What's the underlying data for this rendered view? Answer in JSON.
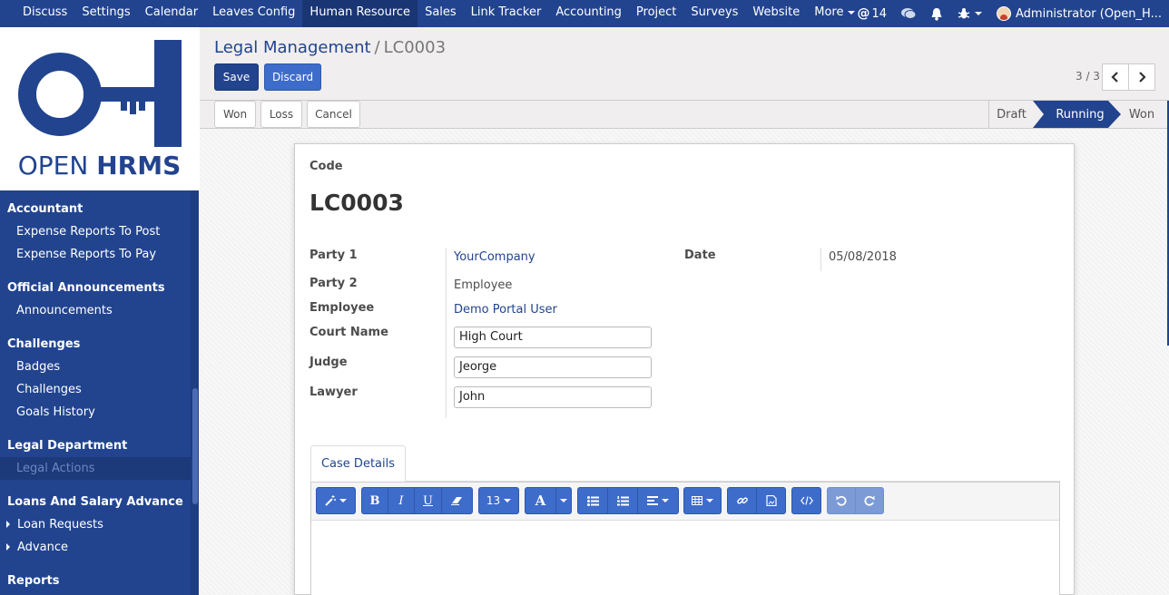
{
  "topnav": {
    "menu": [
      "Discuss",
      "Settings",
      "Calendar",
      "Leaves Config",
      "Human Resource",
      "Sales",
      "Link Tracker",
      "Accounting",
      "Project",
      "Surveys",
      "Website"
    ],
    "more_label": "More",
    "mentions_count": "14",
    "user_label": "Administrator (Open_H..."
  },
  "logo": {
    "word1": "OPEN",
    "word2": "HRMS"
  },
  "sidebar": {
    "sections": [
      {
        "title": "Accountant",
        "items": [
          "Expense Reports To Post",
          "Expense Reports To Pay"
        ]
      },
      {
        "title": "Official Announcements",
        "items": [
          "Announcements"
        ]
      },
      {
        "title": "Challenges",
        "items": [
          "Badges",
          "Challenges",
          "Goals History"
        ]
      },
      {
        "title": "Legal Department",
        "items": [
          "Legal Actions"
        ]
      },
      {
        "title": "Loans And Salary Advance",
        "items": [
          "Loan Requests",
          "Advance"
        ]
      },
      {
        "title": "Reports",
        "items": []
      }
    ]
  },
  "breadcrumb": {
    "parent": "Legal Management",
    "sep": "/",
    "current": "LC0003"
  },
  "buttons": {
    "save": "Save",
    "discard": "Discard"
  },
  "pager": {
    "text": "3 / 3"
  },
  "status_buttons": {
    "won": "Won",
    "loss": "Loss",
    "cancel": "Cancel"
  },
  "stages": {
    "draft": "Draft",
    "running": "Running",
    "won": "Won"
  },
  "form": {
    "code_label": "Code",
    "code_value": "LC0003",
    "party1_label": "Party 1",
    "party1_value": "YourCompany",
    "party2_label": "Party 2",
    "party2_value": "Employee",
    "employee_label": "Employee",
    "employee_value": "Demo Portal User",
    "court_label": "Court Name",
    "court_value": "High Court",
    "judge_label": "Judge",
    "judge_value": "Jeorge",
    "lawyer_label": "Lawyer",
    "lawyer_value": "John",
    "date_label": "Date",
    "date_value": "05/08/2018"
  },
  "tabs": {
    "case_details": "Case Details"
  },
  "editor": {
    "font_size": "13"
  },
  "colors": {
    "primary": "#22448f",
    "accent": "#3e6cca"
  }
}
